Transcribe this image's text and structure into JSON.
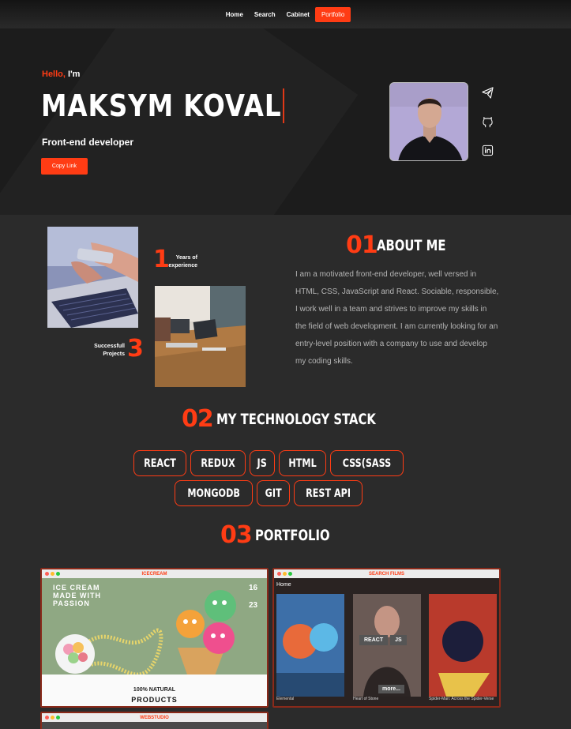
{
  "nav": {
    "items": [
      "Home",
      "Search",
      "Cabinet",
      "Portfolio"
    ],
    "active": "Portfolio"
  },
  "hero": {
    "greeting_highlight": "Hello,",
    "greeting_rest": " I'm",
    "name": "MAKSYM KOVAL",
    "role": "Front-end developer",
    "button": "Copy Link",
    "social_icons": [
      "telegram-icon",
      "github-icon",
      "linkedin-icon"
    ]
  },
  "about": {
    "years_number": "1",
    "years_label_1": "Years of",
    "years_label_2": "experience",
    "projects_number": "3",
    "projects_label_1": "Successfull",
    "projects_label_2": "Projects",
    "section_number": "01",
    "section_title": "ABOUT ME",
    "text": "I am a motivated front-end developer, well versed in HTML, CSS, JavaScript and React. Sociable, responsible, I work well in a team and strives to improve my skills in the field of web development. I am currently looking for an entry-level position with a company to use and develop my coding skills."
  },
  "stack": {
    "section_number": "02",
    "section_title": "MY TECHNOLOGY STACK",
    "items": [
      "REACT",
      "REDUX",
      "JS",
      "HTML",
      "CSS(SASS",
      "MONGODB",
      "GIT",
      "REST API"
    ]
  },
  "portfolio": {
    "section_number": "03",
    "section_title": "PORTFOLIO",
    "projects": [
      {
        "title": "ICECREAM",
        "headline_1": "ICE CREAM",
        "headline_2": "MADE WITH",
        "headline_3": "PASSION",
        "date_1": "16",
        "date_2": "23",
        "natural": "100% NATURAL",
        "products": "PRODUCTS"
      },
      {
        "title": "SEARCH FILMS",
        "home": "Home",
        "movies": [
          "Elemental",
          "Heart of Stone",
          "Spider-Man: Across the Spider-Verse"
        ],
        "tags": [
          "REACT",
          "JS"
        ],
        "more": "more..."
      },
      {
        "title": "WEBSTUDIO"
      }
    ]
  },
  "colors": {
    "accent": "#ff3c14",
    "background": "#2b2b2b",
    "hero_background": "#1c1c1c"
  }
}
